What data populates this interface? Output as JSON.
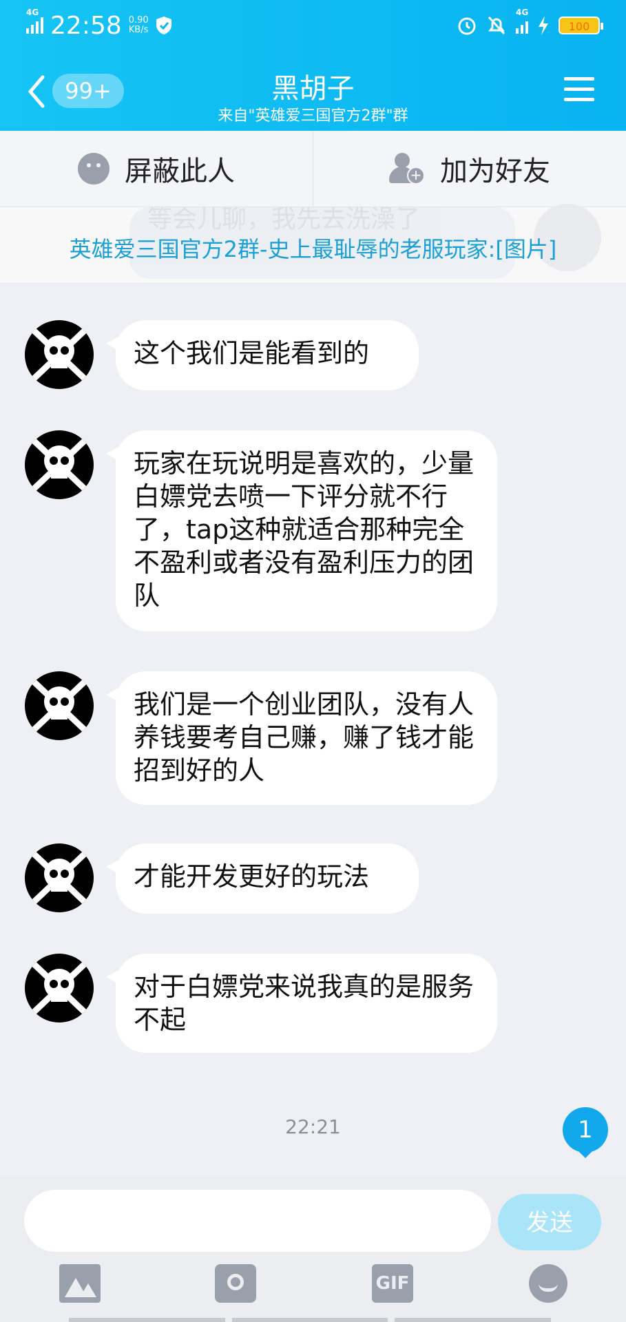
{
  "status_bar": {
    "network": "4G",
    "time": "22:58",
    "speed_value": "0.90",
    "speed_unit": "KB/s",
    "network_right": "4G",
    "battery": "100"
  },
  "nav": {
    "back_badge": "99+",
    "title": "黑胡子",
    "subtitle": "来自\"英雄爱三国官方2群\"群"
  },
  "actions": {
    "block_label": "屏蔽此人",
    "add_friend_label": "加为好友"
  },
  "notice": {
    "ghost_text": "等会儿聊，我先去洗澡了",
    "text": "英雄爱三国官方2群-史上最耻辱的老服玩家:[图片]"
  },
  "messages": [
    {
      "text": "这个我们是能看到的"
    },
    {
      "text": "玩家在玩说明是喜欢的，少量白嫖党去喷一下评分就不行了，tap这种就适合那种完全不盈利或者没有盈利压力的团队"
    },
    {
      "text": "我们是一个创业团队，没有人养钱要考自己赚，赚了钱才能招到好的人"
    },
    {
      "text": "才能开发更好的玩法"
    },
    {
      "text": "对于白嫖党来说我真的是服务不起"
    }
  ],
  "timestamp": "22:21",
  "unread_count": "1",
  "input": {
    "value": "",
    "send_label": "发送"
  },
  "tools": {
    "picture": "image-icon",
    "camera": "camera-icon",
    "gif": "GIF",
    "emoji": "emoji-icon"
  },
  "colors": {
    "header": "#0db8f2",
    "notice_text": "#1a9fd6",
    "send_button": "#a9e4f8",
    "unread_badge": "#12a9ec"
  }
}
